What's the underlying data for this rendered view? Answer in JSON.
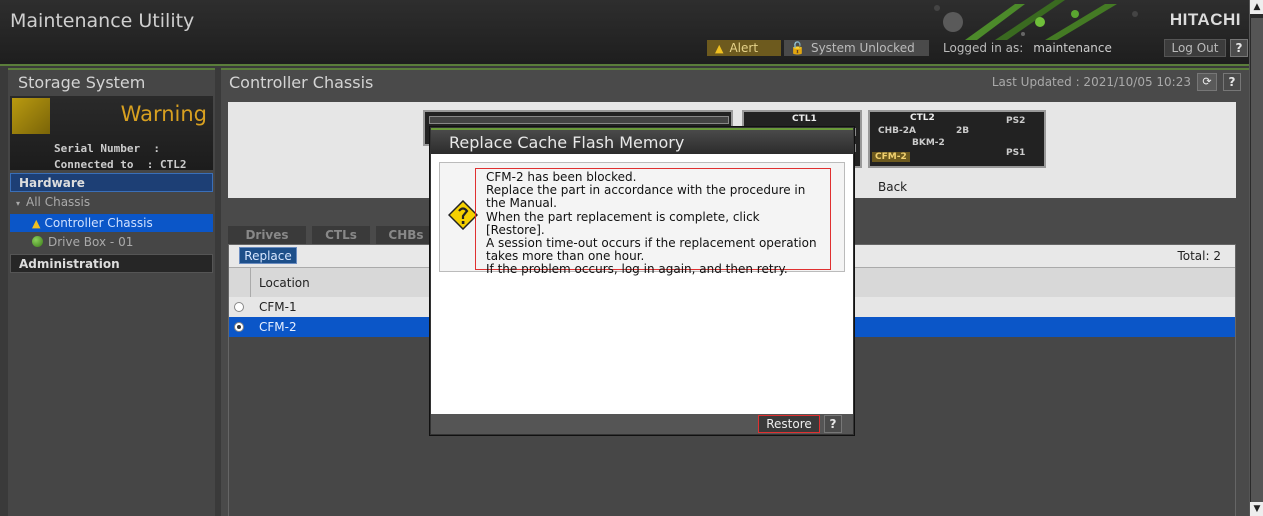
{
  "header": {
    "app_title": "Maintenance Utility",
    "brand": "HITACHI",
    "alert_label": "Alert",
    "system_status": "System Unlocked",
    "logged_in_label": "Logged in as:",
    "username": "maintenance",
    "logout_label": "Log Out",
    "help_label": "?"
  },
  "sidebar": {
    "title": "Storage System",
    "status": "Warning",
    "serial_label": "Serial Number",
    "serial_value": ":",
    "connected_label": "Connected to",
    "connected_value": ": CTL2",
    "hardware_header": "Hardware",
    "tree": {
      "all_chassis": "All Chassis",
      "controller_chassis": "Controller Chassis",
      "drive_box": "Drive Box - 01"
    },
    "administration_header": "Administration"
  },
  "main": {
    "title": "Controller Chassis",
    "last_updated": "Last Updated : 2021/10/05 10:23",
    "help_label": "?",
    "chassis": {
      "ctl1": "CTL1",
      "ctl2": "CTL2",
      "chb_2a": "CHB-2A",
      "slot_2b": "2B",
      "bkm_2": "BKM-2",
      "cfm_2": "CFM-2",
      "ps1": "PS1",
      "ps2": "PS2",
      "back_label": "Back"
    },
    "tabs": [
      "Drives",
      "CTLs",
      "CHBs"
    ],
    "replace_label": "Replace",
    "total": "Total: 2",
    "column_header": "Location",
    "rows": [
      {
        "location": "CFM-1",
        "selected": false
      },
      {
        "location": "CFM-2",
        "selected": true
      }
    ]
  },
  "modal": {
    "title": "Replace Cache Flash Memory",
    "message_lines": [
      "CFM-2 has been blocked.",
      "Replace the part in accordance with the procedure in the Manual.",
      "When the part replacement is complete, click [Restore].",
      "A session time-out occurs if the replacement operation takes more than one hour.",
      "If the problem occurs, log in again, and then retry."
    ],
    "restore_label": "Restore",
    "help_label": "?"
  },
  "colors": {
    "accent_green": "#5a7d3a",
    "selection_blue": "#0b56c8",
    "warning_yellow": "#d8a020",
    "highlight_red": "#e03030"
  }
}
